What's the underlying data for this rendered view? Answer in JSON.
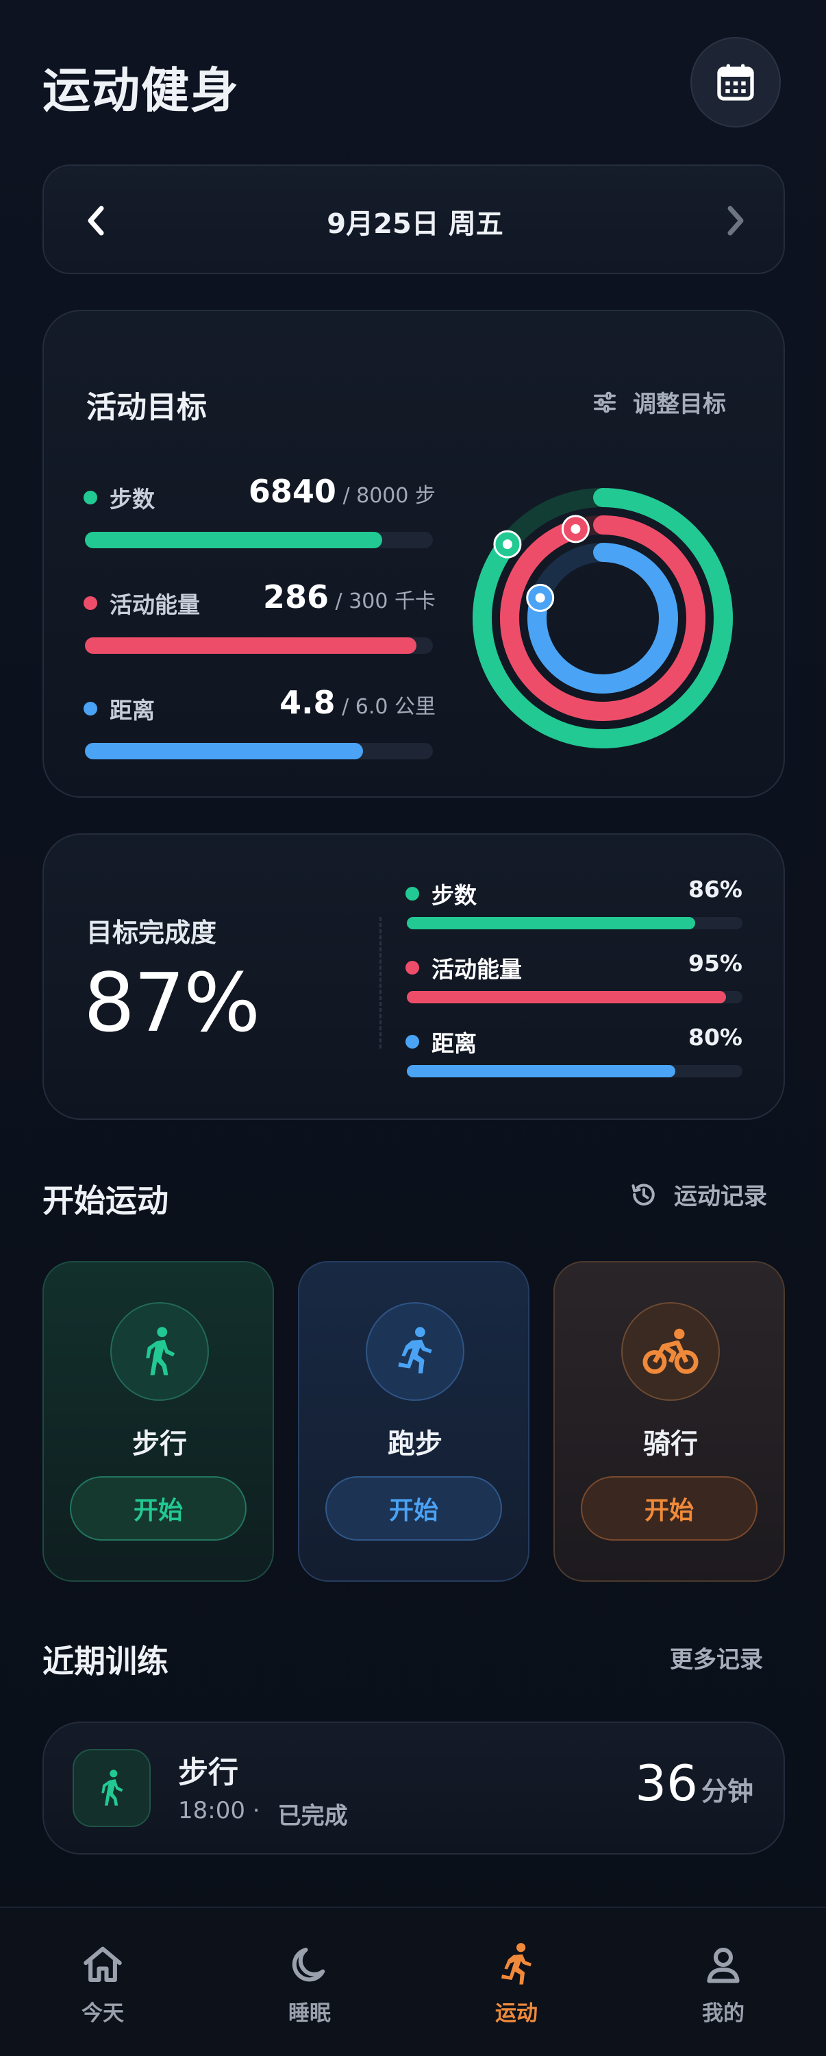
{
  "header": {
    "title": "运动健身",
    "calendar_icon": "calendar-icon"
  },
  "date_bar": {
    "date": "9月25日  周五",
    "prev_icon": "chevron-left-icon",
    "next_icon": "chevron-right-icon"
  },
  "activity_goals": {
    "title": "活动目标",
    "adjust_label": "调整目标",
    "metrics": [
      {
        "label": "步数",
        "value": "6840",
        "target": " / 8000 步",
        "color": "#22c993",
        "fraction": 0.855
      },
      {
        "label": "活动能量",
        "value": "286",
        "target": " / 300 千卡",
        "color": "#ee4d69",
        "fraction": 0.953
      },
      {
        "label": "距离",
        "value": "4.8",
        "target": " / 6.0 公里",
        "color": "#4aa3f5",
        "fraction": 0.8
      }
    ]
  },
  "completion": {
    "label": "目标完成度",
    "value": "87%",
    "items": [
      {
        "label": "步数",
        "percent": "86%",
        "fraction": 0.86,
        "color": "#22c993"
      },
      {
        "label": "活动能量",
        "percent": "95%",
        "fraction": 0.95,
        "color": "#ee4d69"
      },
      {
        "label": "距离",
        "percent": "80%",
        "fraction": 0.8,
        "color": "#4aa3f5"
      }
    ]
  },
  "start_exercise": {
    "title": "开始运动",
    "history_label": "运动记录",
    "sports": [
      {
        "name": "步行",
        "button": "开始",
        "color": "#22c993"
      },
      {
        "name": "跑步",
        "button": "开始",
        "color": "#4aa3f5"
      },
      {
        "name": "骑行",
        "button": "开始",
        "color": "#f08a3a"
      }
    ]
  },
  "recent": {
    "title": "近期训练",
    "more_label": "更多记录",
    "items": [
      {
        "name": "步行",
        "time": "18:00 ·",
        "status": "已完成",
        "duration": "36",
        "unit": "分钟"
      }
    ]
  },
  "tabbar": {
    "tabs": [
      {
        "label": "今天",
        "icon": "home-icon",
        "active": false
      },
      {
        "label": "睡眠",
        "icon": "moon-icon",
        "active": false
      },
      {
        "label": "运动",
        "icon": "running-icon",
        "active": true
      },
      {
        "label": "我的",
        "icon": "user-icon",
        "active": false
      }
    ],
    "active_color": "#f08a3a"
  }
}
